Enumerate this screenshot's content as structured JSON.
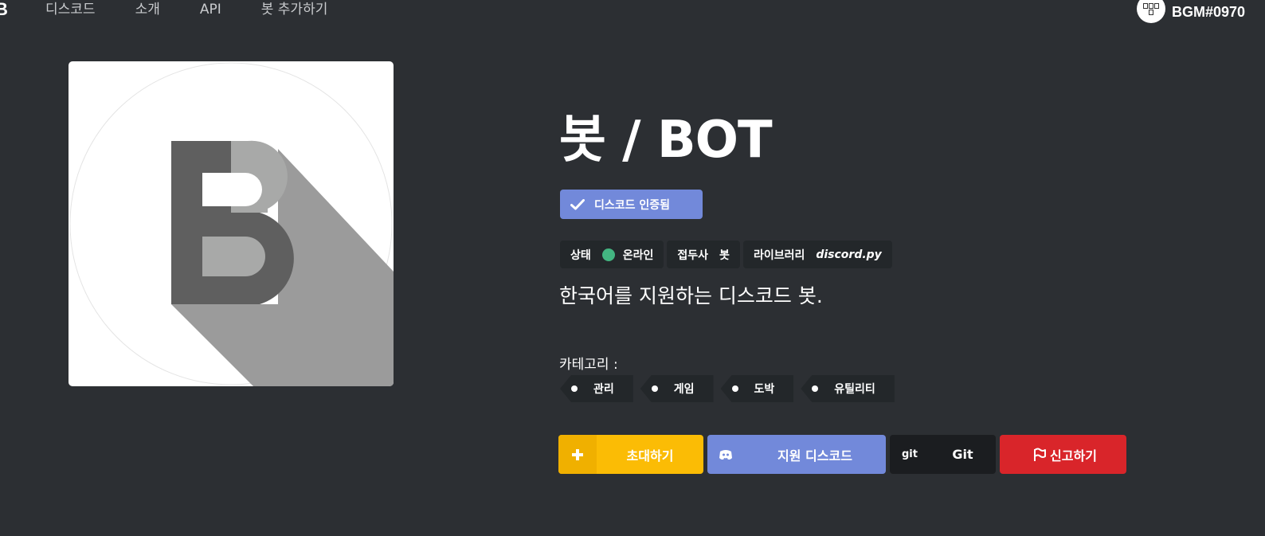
{
  "nav": {
    "logo_glyph": "B",
    "links": [
      "디스코드",
      "소개",
      "API",
      "봇 추가하기"
    ],
    "user_name": "BGM#0970"
  },
  "bot": {
    "title": "봇 / BOT",
    "verified_label": "디스코드 인증됨",
    "meta": {
      "status_label": "상태",
      "status_value": "온라인",
      "status_color": "#43b581",
      "prefix_label": "접두사",
      "prefix_value": "봇",
      "library_label": "라이브러리",
      "library_value": "discord.py"
    },
    "description": "한국어를 지원하는 디스코드 봇.",
    "category_label": "카테고리 :",
    "categories": [
      "관리",
      "게임",
      "도박",
      "유틸리티"
    ]
  },
  "actions": {
    "invite_label": "초대하기",
    "support_label": "지원 디스코드",
    "git_icon_text": "git",
    "git_label": "Git",
    "report_label": "신고하기"
  },
  "colors": {
    "background": "#2c2f33",
    "verified": "#7289da",
    "invite": "#fbbc05",
    "support": "#7289da",
    "git": "#1b1d20",
    "report": "#d9252a"
  }
}
